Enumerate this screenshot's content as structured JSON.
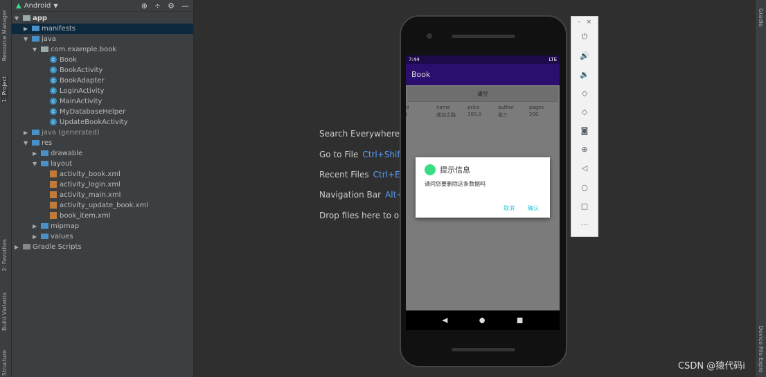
{
  "stripe_left": {
    "resource_manager": "Resource Manager",
    "project": "1: Project",
    "favorites": "2: Favorites",
    "build_variants": "Build Variants",
    "structure": "Structure"
  },
  "stripe_right": {
    "gradle": "Gradle",
    "device_file_explorer": "Device File Explo"
  },
  "project": {
    "view": "Android",
    "tree": [
      {
        "label": "app",
        "depth": 0,
        "type": "module",
        "arrow": "▼"
      },
      {
        "label": "manifests",
        "depth": 1,
        "type": "folder",
        "arrow": "▶",
        "selected": true
      },
      {
        "label": "java",
        "depth": 1,
        "type": "folder",
        "arrow": "▼"
      },
      {
        "label": "com.example.book",
        "depth": 2,
        "type": "package",
        "arrow": "▼"
      },
      {
        "label": "Book",
        "depth": 3,
        "type": "class"
      },
      {
        "label": "BookActivity",
        "depth": 3,
        "type": "class"
      },
      {
        "label": "BookAdapter",
        "depth": 3,
        "type": "class"
      },
      {
        "label": "LoginActivity",
        "depth": 3,
        "type": "class"
      },
      {
        "label": "MainActivity",
        "depth": 3,
        "type": "class"
      },
      {
        "label": "MyDatabaseHelper",
        "depth": 3,
        "type": "class"
      },
      {
        "label": "UpdateBookActivity",
        "depth": 3,
        "type": "class"
      },
      {
        "label": "java (generated)",
        "depth": 1,
        "type": "folder",
        "arrow": "▶"
      },
      {
        "label": "res",
        "depth": 1,
        "type": "folder",
        "arrow": "▼"
      },
      {
        "label": "drawable",
        "depth": 2,
        "type": "folder",
        "arrow": "▶"
      },
      {
        "label": "layout",
        "depth": 2,
        "type": "folder",
        "arrow": "▼"
      },
      {
        "label": "activity_book.xml",
        "depth": 3,
        "type": "xml"
      },
      {
        "label": "activity_login.xml",
        "depth": 3,
        "type": "xml"
      },
      {
        "label": "activity_main.xml",
        "depth": 3,
        "type": "xml"
      },
      {
        "label": "activity_update_book.xml",
        "depth": 3,
        "type": "xml"
      },
      {
        "label": "book_item.xml",
        "depth": 3,
        "type": "xml"
      },
      {
        "label": "mipmap",
        "depth": 2,
        "type": "folder",
        "arrow": "▶"
      },
      {
        "label": "values",
        "depth": 2,
        "type": "folder",
        "arrow": "▶"
      },
      {
        "label": "Gradle Scripts",
        "depth": 0,
        "type": "gradle",
        "arrow": "▶"
      }
    ]
  },
  "editor_hints": [
    {
      "label": "Search Everywhere",
      "key": ""
    },
    {
      "label": "Go to File",
      "key": "Ctrl+Shif"
    },
    {
      "label": "Recent Files",
      "key": "Ctrl+E"
    },
    {
      "label": "Navigation Bar",
      "key": "Alt+"
    },
    {
      "label": "Drop files here to op",
      "key": ""
    }
  ],
  "phone": {
    "time": "7:44",
    "network": "LTE",
    "app_title": "Book",
    "clear_button": "清空",
    "columns": [
      "id",
      "name",
      "price",
      "author",
      "pages"
    ],
    "row": [
      "1",
      "成功之路",
      "100.0",
      "张三",
      "200"
    ],
    "dialog": {
      "title": "提示信息",
      "message": "请问您要删除这条数据吗",
      "cancel": "取消",
      "confirm": "确认"
    },
    "nav": [
      "back",
      "home",
      "recents"
    ]
  },
  "emulator_toolbar": [
    "minimize",
    "close",
    "power",
    "volume-up",
    "volume-down",
    "rotate-left",
    "rotate-right",
    "screenshot",
    "zoom",
    "back",
    "home",
    "overview",
    "more"
  ],
  "watermark": "CSDN @猿代码i",
  "colors": {
    "app_bar": "#3700b3",
    "dialog_button": "#26c6da",
    "selection": "#0d293e"
  }
}
